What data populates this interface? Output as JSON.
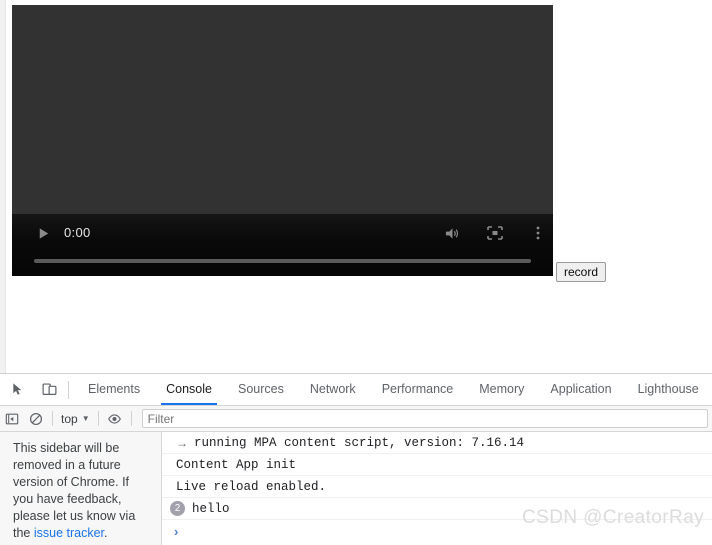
{
  "page": {
    "video": {
      "play_icon": "play-icon",
      "current_time": "0:00",
      "mute_icon": "volume-icon",
      "fullscreen_icon": "picture-in-picture-icon",
      "more_icon": "more-options-icon",
      "progress_percent": 0,
      "background_color": "#323232"
    },
    "record_button_label": "record"
  },
  "devtools": {
    "toolbar_icons": [
      {
        "name": "inspect-element-icon"
      },
      {
        "name": "device-toolbar-icon"
      }
    ],
    "tabs": [
      {
        "label": "Elements",
        "active": false
      },
      {
        "label": "Console",
        "active": true
      },
      {
        "label": "Sources",
        "active": false
      },
      {
        "label": "Network",
        "active": false
      },
      {
        "label": "Performance",
        "active": false
      },
      {
        "label": "Memory",
        "active": false
      },
      {
        "label": "Application",
        "active": false
      },
      {
        "label": "Lighthouse",
        "active": false
      }
    ],
    "active_tab_accent": "#1a73e8",
    "console_toolbar": {
      "sidebar_toggle_icon": "sidebar-toggle-icon",
      "clear_console_icon": "clear-console-icon",
      "context_value": "top",
      "context_caret": "▼",
      "eye_icon": "live-expression-icon",
      "filter_placeholder": "Filter",
      "filter_value": ""
    },
    "sidebar": {
      "notice_text_before_link": "This sidebar will be removed in a future version of Chrome. If you have feedback, please let us know via the ",
      "notice_link_text": "issue tracker",
      "notice_text_after_link": "."
    },
    "console_messages": [
      {
        "prefix": "→",
        "badge": "",
        "text": "running MPA content script, version: 7.16.14"
      },
      {
        "prefix": "",
        "badge": "",
        "text": "Content App init"
      },
      {
        "prefix": "",
        "badge": "",
        "text": "Live reload enabled."
      },
      {
        "prefix": "",
        "badge": "2",
        "text": "hello"
      }
    ],
    "prompt_caret": "›"
  },
  "watermark": "CSDN @CreatorRay"
}
